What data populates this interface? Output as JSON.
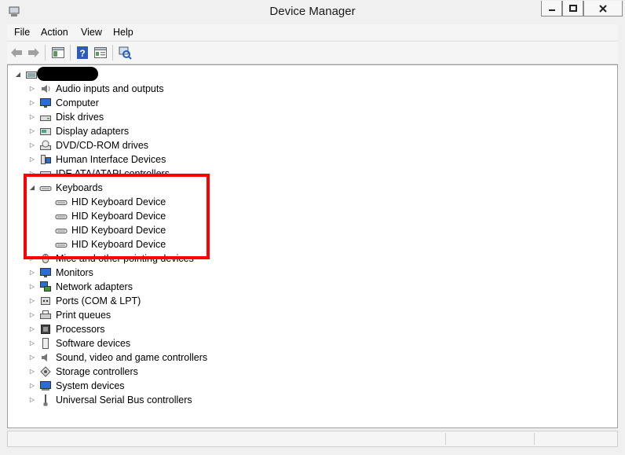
{
  "window": {
    "title": "Device Manager"
  },
  "menu": [
    "File",
    "Action",
    "View",
    "Help"
  ],
  "tree": {
    "root_label": "",
    "categories": [
      {
        "label": "Audio inputs and outputs",
        "icon": "speaker-icon"
      },
      {
        "label": "Computer",
        "icon": "monitor-icon"
      },
      {
        "label": "Disk drives",
        "icon": "disk-drive-icon"
      },
      {
        "label": "Display adapters",
        "icon": "display-adapter-icon"
      },
      {
        "label": "DVD/CD-ROM drives",
        "icon": "dvd-drive-icon"
      },
      {
        "label": "Human Interface Devices",
        "icon": "hid-icon"
      },
      {
        "label": "IDE ATA/ATAPI controllers",
        "icon": "ide-controller-icon"
      },
      {
        "label": "Keyboards",
        "icon": "keyboard-icon",
        "expanded": true,
        "children": [
          "HID Keyboard Device",
          "HID Keyboard Device",
          "HID Keyboard Device",
          "HID Keyboard Device"
        ]
      },
      {
        "label": "Mice and other pointing devices",
        "icon": "mouse-icon"
      },
      {
        "label": "Monitors",
        "icon": "monitor-icon"
      },
      {
        "label": "Network adapters",
        "icon": "network-adapter-icon"
      },
      {
        "label": "Ports (COM & LPT)",
        "icon": "port-icon"
      },
      {
        "label": "Print queues",
        "icon": "printer-icon"
      },
      {
        "label": "Processors",
        "icon": "processor-icon"
      },
      {
        "label": "Software devices",
        "icon": "software-device-icon"
      },
      {
        "label": "Sound, video and game controllers",
        "icon": "sound-icon"
      },
      {
        "label": "Storage controllers",
        "icon": "storage-controller-icon"
      },
      {
        "label": "System devices",
        "icon": "system-device-icon"
      },
      {
        "label": "Universal Serial Bus controllers",
        "icon": "usb-icon"
      }
    ]
  },
  "colors": {
    "highlight": "#ff0000",
    "accent": "#1e6fd0"
  }
}
